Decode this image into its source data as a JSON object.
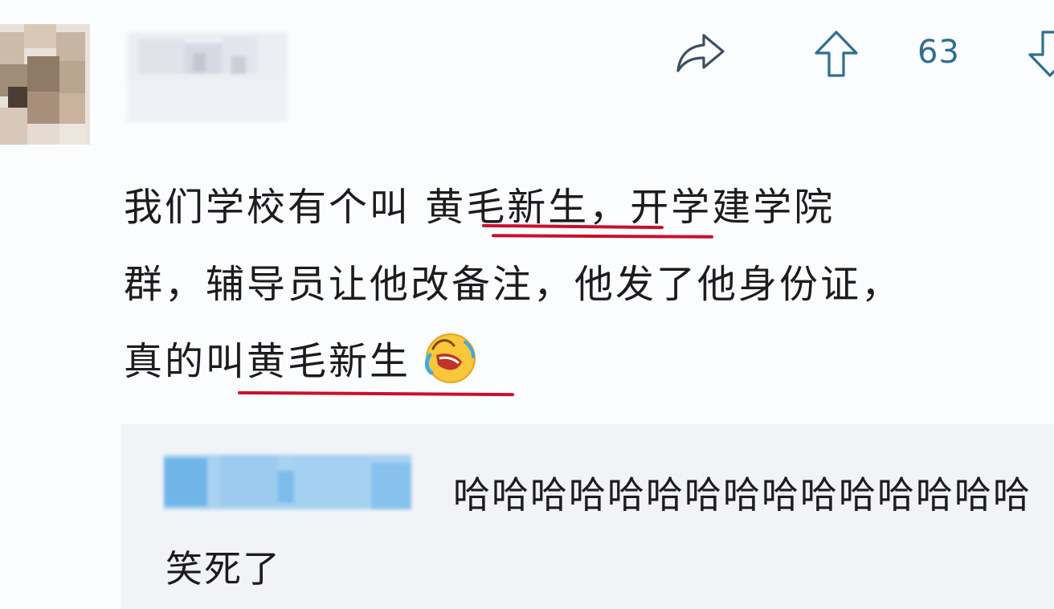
{
  "post": {
    "vote_count": "63",
    "icons": {
      "share": "share-arrow-icon",
      "upvote": "upvote-arrow-icon",
      "downvote": "downvote-arrow-icon",
      "emoji": "laughing-tears-emoji-icon"
    },
    "comment": {
      "line1": "我们学校有个叫 黄毛新生，开学建学院",
      "line2": "群，辅导员让他改备注，他发了他身份证，",
      "line3": "真的叫黄毛新生"
    },
    "reply": {
      "text": "哈哈哈哈哈哈哈哈哈哈哈哈哈哈哈笑死了"
    }
  },
  "colors": {
    "accent": "#2d6f8f",
    "underline": "#c8102e",
    "text": "#1c1c1c"
  }
}
